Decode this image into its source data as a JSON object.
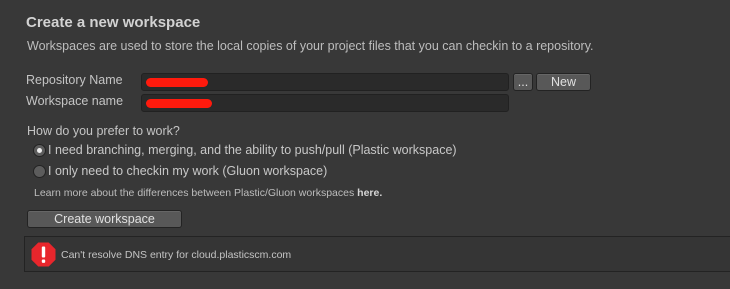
{
  "header": {
    "title": "Create a new workspace",
    "description": "Workspaces are used to store the local copies of your project files that you can checkin to a repository."
  },
  "form": {
    "repository_label": "Repository Name",
    "workspace_label": "Workspace name",
    "browse_button": "...",
    "new_button": "New"
  },
  "work_mode": {
    "question": "How do you prefer to work?",
    "options": [
      {
        "label": "I need branching, merging, and the ability to push/pull (Plastic workspace)",
        "checked": true
      },
      {
        "label": "I only need to checkin my work (Gluon workspace)",
        "checked": false
      }
    ],
    "learn_more_text": "Learn more about the differences between Plastic/Gluon workspaces",
    "learn_more_link": "here."
  },
  "actions": {
    "create_button": "Create workspace"
  },
  "error": {
    "message": "Can't resolve DNS entry for cloud.plasticscm.com"
  },
  "colors": {
    "background": "#383838",
    "field_bg": "#2a2a2a",
    "button_bg": "#585858",
    "error_red": "#e8262c"
  }
}
